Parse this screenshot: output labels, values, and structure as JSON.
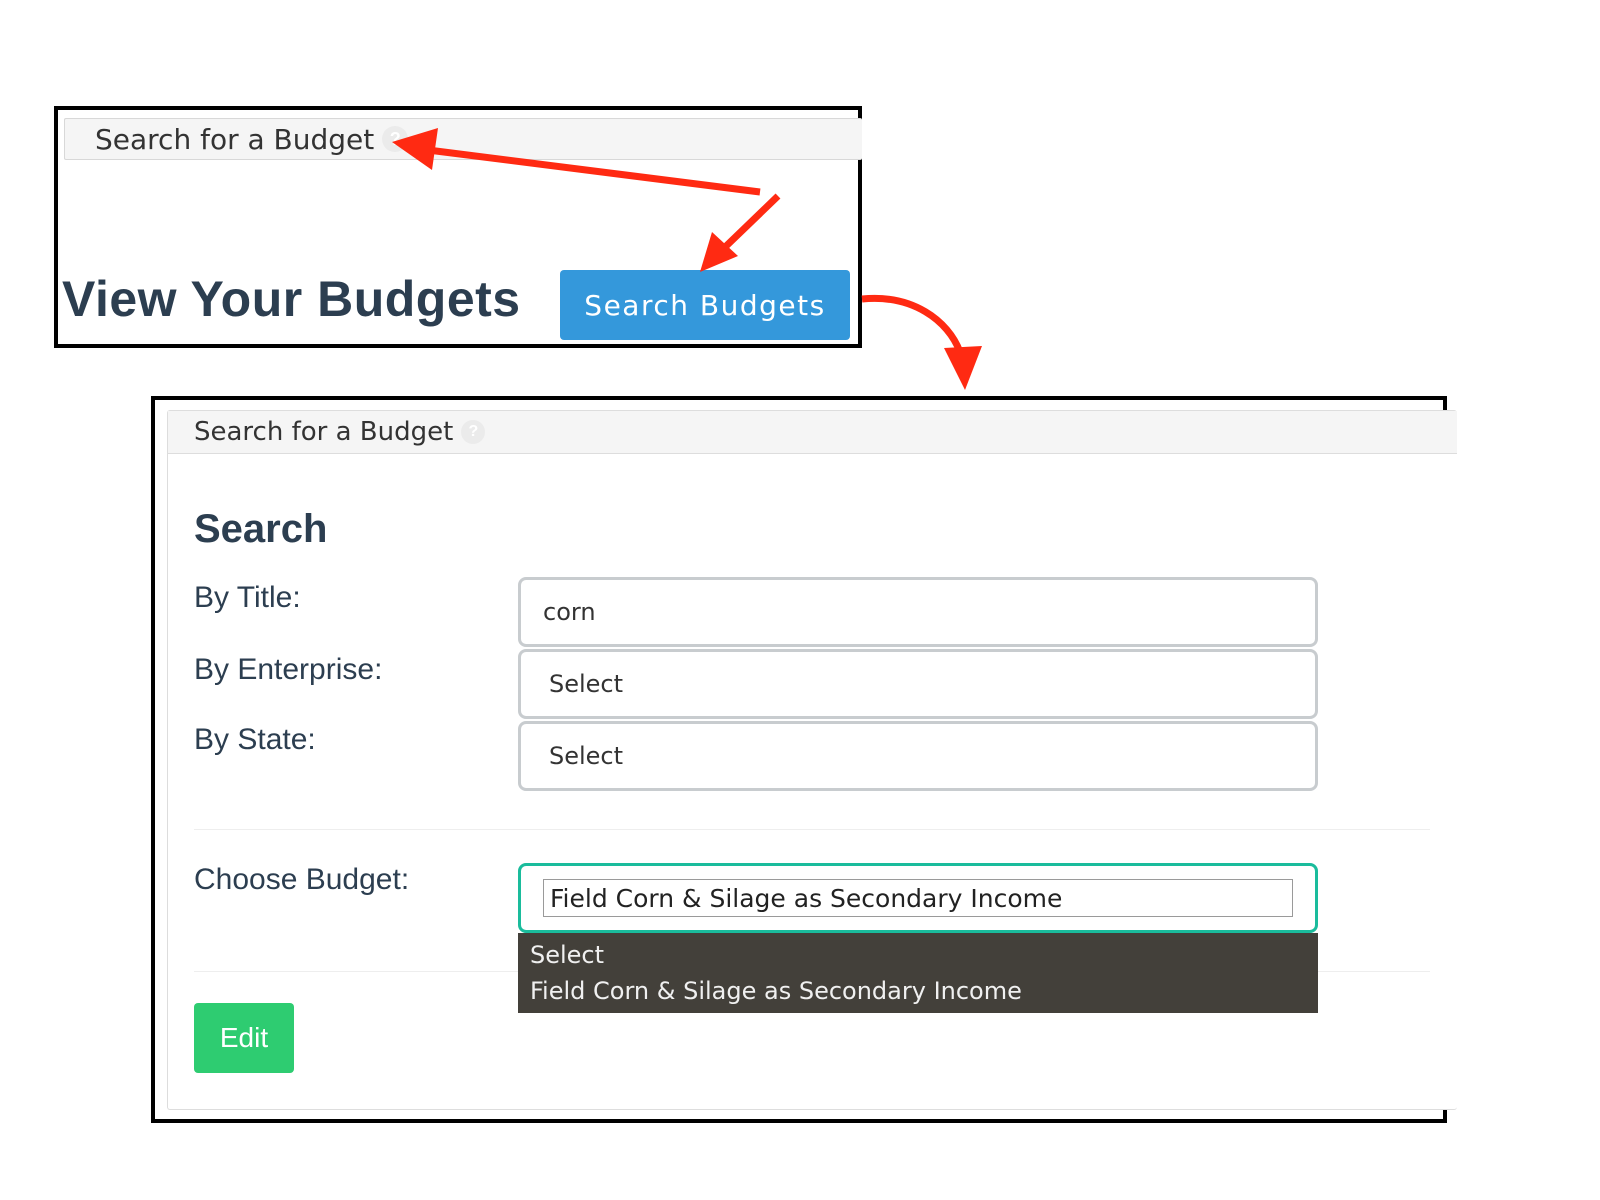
{
  "top_panel": {
    "header_title": "Search for a Budget",
    "help_icon": "question-mark-icon",
    "view_title": "View Your Budgets",
    "search_button_label": "Search Budgets"
  },
  "search_panel": {
    "header_title": "Search for a Budget",
    "help_icon": "question-mark-icon",
    "heading": "Search",
    "fields": {
      "title_label": "By Title:",
      "title_value": "corn",
      "enterprise_label": "By Enterprise:",
      "enterprise_value": "Select",
      "state_label": "By State:",
      "state_value": "Select"
    },
    "choose_budget": {
      "label": "Choose Budget:",
      "selected": "Field Corn & Silage as Secondary Income",
      "options": [
        "Select",
        "Field Corn & Silage as Secondary Income"
      ]
    },
    "edit_button_label": "Edit"
  },
  "colors": {
    "primary_button": "#3498db",
    "edit_button": "#2ecc71",
    "focus_border": "#1abc9c",
    "annotation_arrow": "#ff2a12",
    "dropdown_bg": "#43403a"
  }
}
